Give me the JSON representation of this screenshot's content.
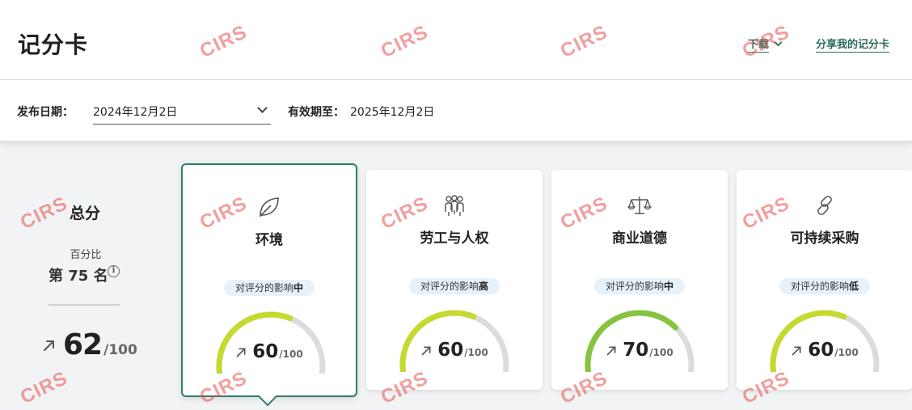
{
  "header": {
    "title": "记分卡",
    "download_label": "下载",
    "share_label": "分享我的记分卡"
  },
  "filters": {
    "issue_date_label": "发布日期：",
    "issue_date_value": "2024年12月2日",
    "valid_until_label": "有效期至：",
    "valid_until_value": "2025年12月2日"
  },
  "overall": {
    "title": "总分",
    "percentile_label": "百分比",
    "percentile_value": "第 75 名",
    "info_glyph": "i",
    "score": "62",
    "score_denominator": "/100",
    "trend_icon": "arrow-up-right-icon"
  },
  "cards": [
    {
      "title": "环境",
      "icon": "leaf-icon",
      "impact_prefix": "对评分的影响",
      "impact_level": "中",
      "score": "60",
      "score_value": 60,
      "denominator": "/100",
      "selected": true,
      "gauge_color": "#c5d92f"
    },
    {
      "title": "劳工与人权",
      "icon": "people-group-icon",
      "impact_prefix": "对评分的影响",
      "impact_level": "高",
      "score": "60",
      "score_value": 60,
      "denominator": "/100",
      "selected": false,
      "gauge_color": "#c5d92f"
    },
    {
      "title": "商业道德",
      "icon": "scales-icon",
      "impact_prefix": "对评分的影响",
      "impact_level": "中",
      "score": "70",
      "score_value": 70,
      "denominator": "/100",
      "selected": false,
      "gauge_color": "#86c440"
    },
    {
      "title": "可持续采购",
      "icon": "chain-link-icon",
      "impact_prefix": "对评分的影响",
      "impact_level": "低",
      "score": "60",
      "score_value": 60,
      "denominator": "/100",
      "selected": false,
      "gauge_color": "#c5d92f"
    }
  ],
  "colors": {
    "accent": "#2f7d6a",
    "gauge_track": "#dcdcdc",
    "badge_bg": "#e6f1fa"
  },
  "watermark": {
    "text": "CIRS"
  }
}
